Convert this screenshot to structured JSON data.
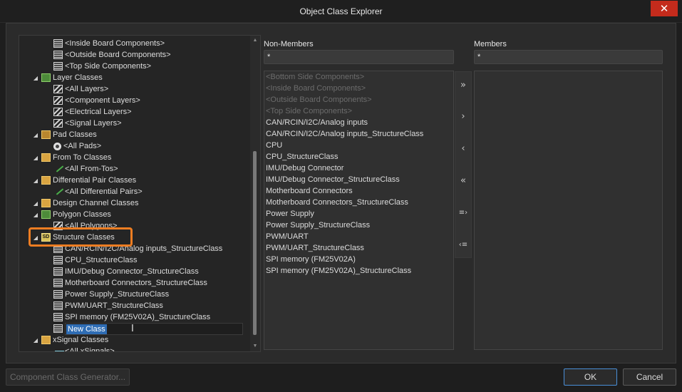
{
  "window": {
    "title": "Object Class Explorer",
    "close_glyph": "✕"
  },
  "tree": {
    "items": [
      {
        "label": "<Inside Board Components>",
        "icon": "class-icon"
      },
      {
        "label": "<Outside Board Components>",
        "icon": "class-icon"
      },
      {
        "label": "<Top Side Components>",
        "icon": "class-icon"
      },
      {
        "label": "Layer Classes",
        "icon": "layer-folder-icon",
        "expanded": true
      },
      {
        "label": "<All Layers>",
        "icon": "layer-class-icon"
      },
      {
        "label": "<Component Layers>",
        "icon": "layer-class-icon"
      },
      {
        "label": "<Electrical Layers>",
        "icon": "layer-class-icon"
      },
      {
        "label": "<Signal Layers>",
        "icon": "layer-class-icon"
      },
      {
        "label": "Pad Classes",
        "icon": "pad-folder-icon",
        "expanded": true
      },
      {
        "label": "<All Pads>",
        "icon": "pad-icon"
      },
      {
        "label": "From To Classes",
        "icon": "folder-icon",
        "expanded": true
      },
      {
        "label": "<All From-Tos>",
        "icon": "from-to-icon"
      },
      {
        "label": "Differential Pair Classes",
        "icon": "folder-icon",
        "expanded": true
      },
      {
        "label": "<All Differential Pairs>",
        "icon": "diff-pair-icon"
      },
      {
        "label": "Design Channel Classes",
        "icon": "folder-icon"
      },
      {
        "label": "Polygon Classes",
        "icon": "polygon-folder-icon",
        "expanded": true
      },
      {
        "label": "<All Polygons>",
        "icon": "polygon-class-icon"
      },
      {
        "label": "Structure Classes",
        "icon": "structure-folder-icon",
        "expanded": true
      },
      {
        "label": "CAN/RCIN/I2C/Analog inputs_StructureClass",
        "icon": "class-icon"
      },
      {
        "label": "CPU_StructureClass",
        "icon": "class-icon"
      },
      {
        "label": "IMU/Debug Connector_StructureClass",
        "icon": "class-icon"
      },
      {
        "label": "Motherboard Connectors_StructureClass",
        "icon": "class-icon"
      },
      {
        "label": "Power Supply_StructureClass",
        "icon": "class-icon"
      },
      {
        "label": "PWM/UART_StructureClass",
        "icon": "class-icon"
      },
      {
        "label": "SPI memory (FM25V02A)_StructureClass",
        "icon": "class-icon"
      },
      {
        "label": "New Class",
        "icon": "class-icon",
        "editing": true
      },
      {
        "label": "xSignal Classes",
        "icon": "folder-icon",
        "expanded": true
      },
      {
        "label": "<All xSignals>",
        "icon": "xsignal-icon"
      }
    ],
    "expander_glyph": "◢",
    "cursor_glyph": "I",
    "scroll_up_glyph": "▲",
    "scroll_down_glyph": "▼"
  },
  "non_members": {
    "label": "Non-Members",
    "filter_value": "*",
    "items": [
      {
        "label": "<Bottom Side Components>",
        "disabled": true
      },
      {
        "label": "<Inside Board Components>",
        "disabled": true
      },
      {
        "label": "<Outside Board Components>",
        "disabled": true
      },
      {
        "label": "<Top Side Components>",
        "disabled": true
      },
      {
        "label": "CAN/RCIN/I2C/Analog inputs",
        "disabled": false
      },
      {
        "label": "CAN/RCIN/I2C/Analog inputs_StructureClass",
        "disabled": false
      },
      {
        "label": "CPU",
        "disabled": false
      },
      {
        "label": "CPU_StructureClass",
        "disabled": false
      },
      {
        "label": "IMU/Debug Connector",
        "disabled": false
      },
      {
        "label": "IMU/Debug Connector_StructureClass",
        "disabled": false
      },
      {
        "label": "Motherboard Connectors",
        "disabled": false
      },
      {
        "label": "Motherboard Connectors_StructureClass",
        "disabled": false
      },
      {
        "label": "Power Supply",
        "disabled": false
      },
      {
        "label": "Power Supply_StructureClass",
        "disabled": false
      },
      {
        "label": "PWM/UART",
        "disabled": false
      },
      {
        "label": "PWM/UART_StructureClass",
        "disabled": false
      },
      {
        "label": "SPI memory (FM25V02A)",
        "disabled": false
      },
      {
        "label": "SPI memory (FM25V02A)_StructureClass",
        "disabled": false
      }
    ]
  },
  "members": {
    "label": "Members",
    "filter_value": "*"
  },
  "move_buttons": {
    "add_all": "»",
    "add": "›",
    "remove": "‹",
    "remove_all": "«",
    "add_selected": "≡›",
    "remove_selected": "‹≡"
  },
  "footer": {
    "generator_label": "Component Class Generator...",
    "ok_label": "OK",
    "cancel_label": "Cancel"
  }
}
